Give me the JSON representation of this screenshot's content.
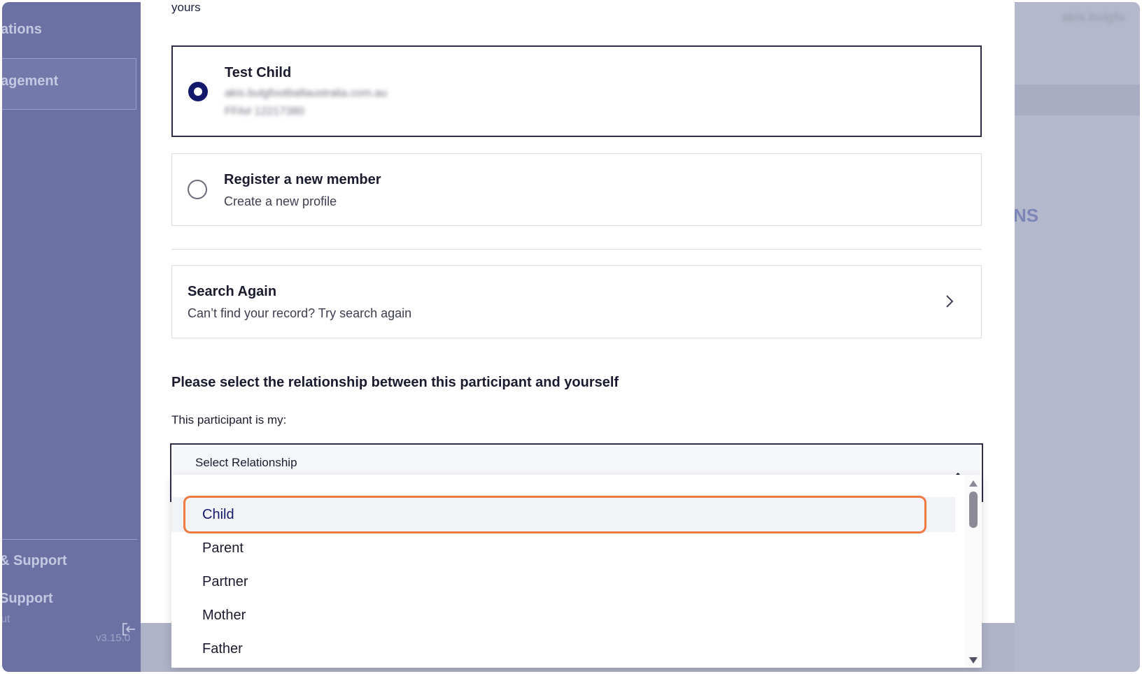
{
  "sidebar": {
    "item_fragment_1": "ations",
    "item_fragment_2": "agement",
    "item_fragment_3": "& Support",
    "item_fragment_4": "Support",
    "item_fragment_5": "ut",
    "version": "v3.15.0"
  },
  "background": {
    "user": "akis.bulgfo",
    "section_fragment": "NS"
  },
  "modal": {
    "intro_text_fragment": "yours",
    "members": [
      {
        "name": "Test Child",
        "email": "akis.bulgfootballaustralia.com.au",
        "id": "FFA# 12217380",
        "selected": true
      },
      {
        "name": "Register a new member",
        "subtitle": "Create a new profile",
        "selected": false
      }
    ],
    "search_again": {
      "title": "Search Again",
      "subtitle": "Can’t find your record? Try search again"
    },
    "relationship": {
      "heading": "Please select the relationship between this participant and yourself",
      "label": "This participant is my:",
      "placeholder": "Select Relationship",
      "options": [
        "Child",
        "Parent",
        "Partner",
        "Mother",
        "Father"
      ],
      "highlighted": "Child"
    }
  },
  "colors": {
    "accent": "#141a6b",
    "highlight_border": "#f07a40",
    "sidebar": "#6b71a3"
  }
}
